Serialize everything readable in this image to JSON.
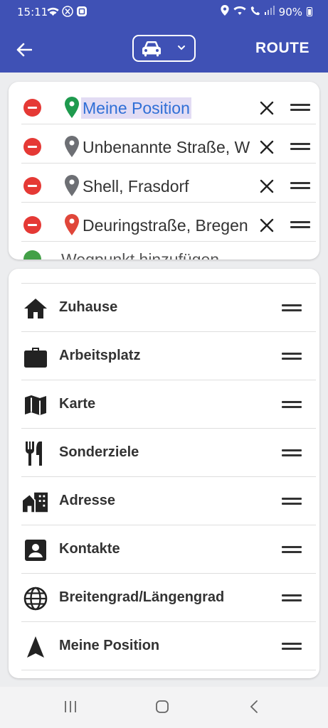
{
  "status_bar": {
    "time": "15:11",
    "battery": "90%",
    "left_icons": [
      "wifi-icon",
      "x-app-icon",
      "tile-app-icon"
    ],
    "right_icons": [
      "location-icon",
      "wifi-call-icon",
      "call-icon",
      "signal-icon",
      "battery-icon"
    ]
  },
  "app_bar": {
    "color": "#3f51b5",
    "back_icon": "arrow-left-icon",
    "transport_mode_icon": "car-icon",
    "route_label": "ROUTE"
  },
  "waypoints": [
    {
      "name": "Meine Position",
      "pin_color": "#1e9a4e",
      "selected": true
    },
    {
      "name": "Unbenannte Straße, W",
      "pin_color": "#6d6f74",
      "selected": false
    },
    {
      "name": "Shell, Frasdorf",
      "pin_color": "#6d6f74",
      "selected": false
    },
    {
      "name": "Deuringstraße, Bregen",
      "pin_color": "#e0463a",
      "selected": false
    }
  ],
  "waypoint_partial": {
    "text": "Wegpunkt hinzufügen"
  },
  "sources": [
    {
      "label": "Zuhause",
      "icon": "home-icon"
    },
    {
      "label": "Arbeitsplatz",
      "icon": "briefcase-icon"
    },
    {
      "label": "Karte",
      "icon": "map-icon"
    },
    {
      "label": "Sonderziele",
      "icon": "restaurant-icon"
    },
    {
      "label": "Adresse",
      "icon": "building-icon"
    },
    {
      "label": "Kontakte",
      "icon": "contact-icon"
    },
    {
      "label": "Breitengrad/Längengrad",
      "icon": "globe-icon"
    },
    {
      "label": "Meine Position",
      "icon": "navigation-arrow-icon"
    }
  ],
  "nav_bar": [
    "recent-apps-icon",
    "home-button-icon",
    "back-nav-icon"
  ]
}
